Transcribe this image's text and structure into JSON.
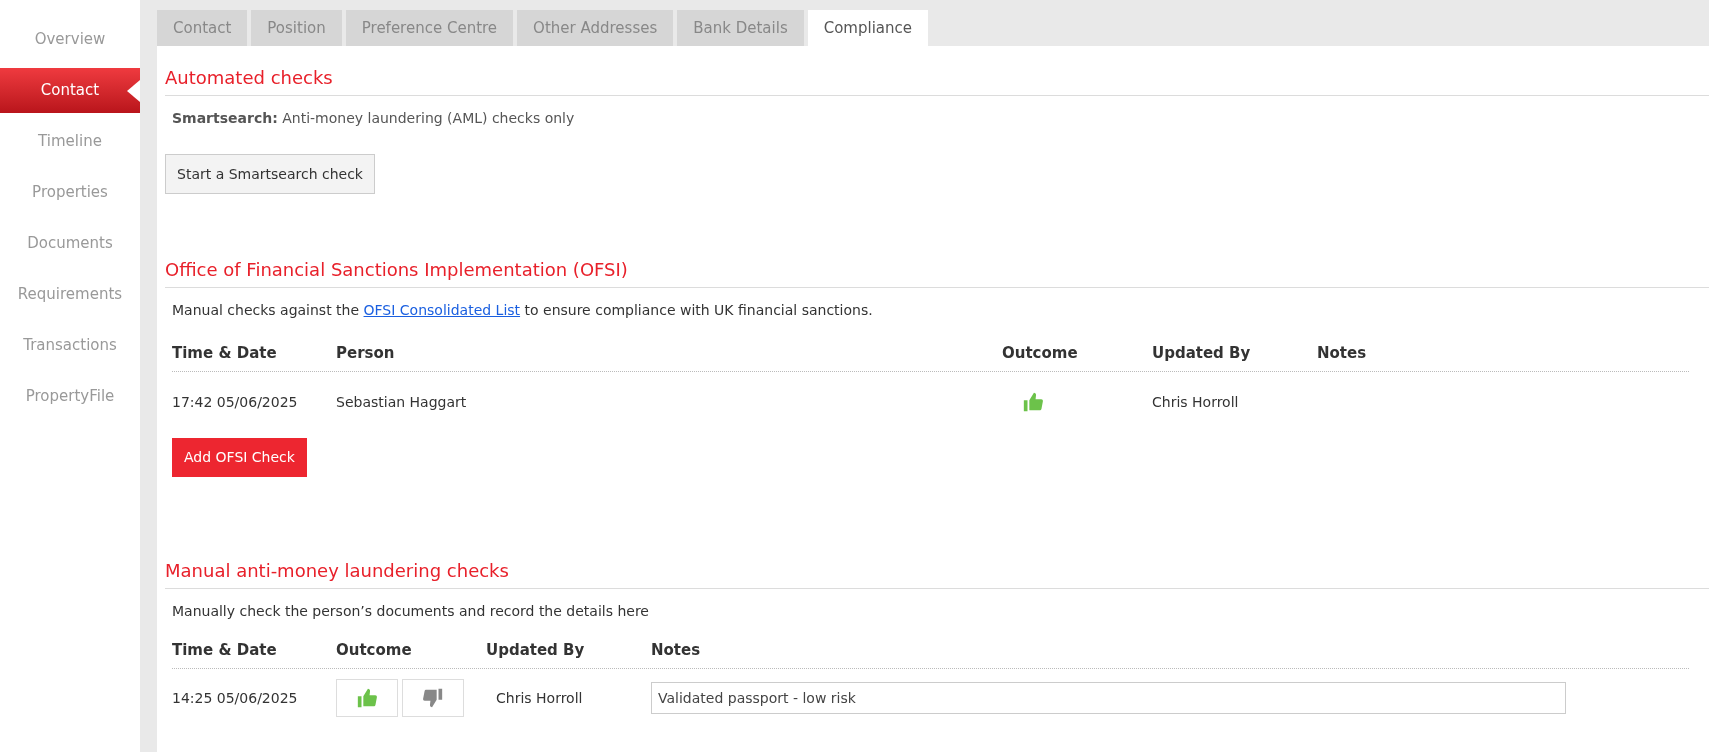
{
  "sidebar": {
    "items": [
      {
        "label": "Overview",
        "selected": false
      },
      {
        "label": "Contact",
        "selected": true
      },
      {
        "label": "Timeline",
        "selected": false
      },
      {
        "label": "Properties",
        "selected": false
      },
      {
        "label": "Documents",
        "selected": false
      },
      {
        "label": "Requirements",
        "selected": false
      },
      {
        "label": "Transactions",
        "selected": false
      },
      {
        "label": "PropertyFile",
        "selected": false
      }
    ]
  },
  "tabs": [
    {
      "label": "Contact",
      "selected": false
    },
    {
      "label": "Position",
      "selected": false
    },
    {
      "label": "Preference Centre",
      "selected": false
    },
    {
      "label": "Other Addresses",
      "selected": false
    },
    {
      "label": "Bank Details",
      "selected": false
    },
    {
      "label": "Compliance",
      "selected": true
    }
  ],
  "automated": {
    "title": "Automated checks",
    "description": "**Smartsearch:** Anti-money laundering (AML) checks only",
    "button": "Start a Smartsearch check"
  },
  "ofsi": {
    "title": "Office of Financial Sanctions Implementation (OFSI)",
    "description_before": "Manual checks against the",
    "link": "OFSI Consolidated List",
    "description_after": "to ensure compliance with UK financial sanctions.",
    "table": {
      "columns": [
        "Time & Date",
        "Person",
        "Outcome",
        "Updated By",
        "Notes"
      ],
      "rows": [
        {
          "time_date": "17:42 05/06/2025",
          "person": "Sebastian Haggart",
          "passed": true,
          "updated_by": "Chris Horroll"
        }
      ]
    },
    "button": "Add OFSI Check"
  },
  "manual": {
    "title": "Manual anti-money laundering checks",
    "description": "Manually check the person’s documents and record the details here",
    "table": {
      "columns": [
        "Time & Date",
        "Outcome",
        "Updated By",
        "Notes"
      ],
      "rows": [
        {
          "time_date": "14:25 05/06/2025",
          "pass_selected": true,
          "fail_selected": false,
          "updated_by": "Chris Horroll",
          "notes": "Validated passport - low risk"
        }
      ]
    }
  }
}
